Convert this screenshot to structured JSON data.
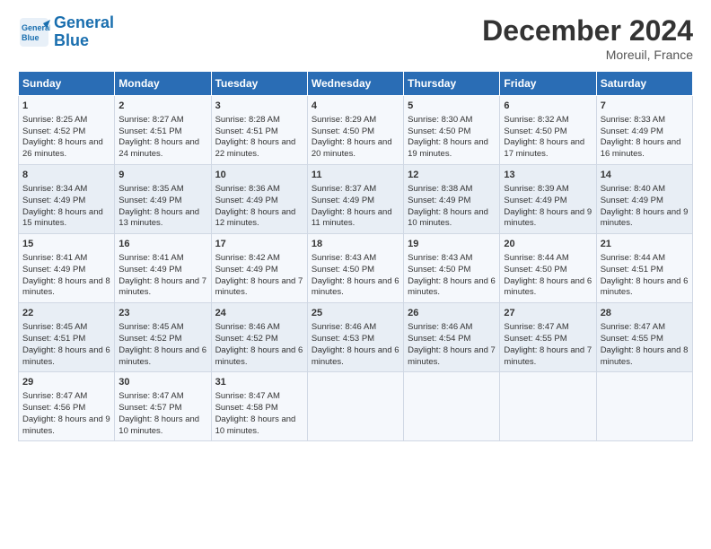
{
  "header": {
    "logo_line1": "General",
    "logo_line2": "Blue",
    "month": "December 2024",
    "location": "Moreuil, France"
  },
  "weekdays": [
    "Sunday",
    "Monday",
    "Tuesday",
    "Wednesday",
    "Thursday",
    "Friday",
    "Saturday"
  ],
  "weeks": [
    [
      {
        "day": "1",
        "sunrise": "8:25 AM",
        "sunset": "4:52 PM",
        "daylight": "8 hours and 26 minutes."
      },
      {
        "day": "2",
        "sunrise": "8:27 AM",
        "sunset": "4:51 PM",
        "daylight": "8 hours and 24 minutes."
      },
      {
        "day": "3",
        "sunrise": "8:28 AM",
        "sunset": "4:51 PM",
        "daylight": "8 hours and 22 minutes."
      },
      {
        "day": "4",
        "sunrise": "8:29 AM",
        "sunset": "4:50 PM",
        "daylight": "8 hours and 20 minutes."
      },
      {
        "day": "5",
        "sunrise": "8:30 AM",
        "sunset": "4:50 PM",
        "daylight": "8 hours and 19 minutes."
      },
      {
        "day": "6",
        "sunrise": "8:32 AM",
        "sunset": "4:50 PM",
        "daylight": "8 hours and 17 minutes."
      },
      {
        "day": "7",
        "sunrise": "8:33 AM",
        "sunset": "4:49 PM",
        "daylight": "8 hours and 16 minutes."
      }
    ],
    [
      {
        "day": "8",
        "sunrise": "8:34 AM",
        "sunset": "4:49 PM",
        "daylight": "8 hours and 15 minutes."
      },
      {
        "day": "9",
        "sunrise": "8:35 AM",
        "sunset": "4:49 PM",
        "daylight": "8 hours and 13 minutes."
      },
      {
        "day": "10",
        "sunrise": "8:36 AM",
        "sunset": "4:49 PM",
        "daylight": "8 hours and 12 minutes."
      },
      {
        "day": "11",
        "sunrise": "8:37 AM",
        "sunset": "4:49 PM",
        "daylight": "8 hours and 11 minutes."
      },
      {
        "day": "12",
        "sunrise": "8:38 AM",
        "sunset": "4:49 PM",
        "daylight": "8 hours and 10 minutes."
      },
      {
        "day": "13",
        "sunrise": "8:39 AM",
        "sunset": "4:49 PM",
        "daylight": "8 hours and 9 minutes."
      },
      {
        "day": "14",
        "sunrise": "8:40 AM",
        "sunset": "4:49 PM",
        "daylight": "8 hours and 9 minutes."
      }
    ],
    [
      {
        "day": "15",
        "sunrise": "8:41 AM",
        "sunset": "4:49 PM",
        "daylight": "8 hours and 8 minutes."
      },
      {
        "day": "16",
        "sunrise": "8:41 AM",
        "sunset": "4:49 PM",
        "daylight": "8 hours and 7 minutes."
      },
      {
        "day": "17",
        "sunrise": "8:42 AM",
        "sunset": "4:49 PM",
        "daylight": "8 hours and 7 minutes."
      },
      {
        "day": "18",
        "sunrise": "8:43 AM",
        "sunset": "4:50 PM",
        "daylight": "8 hours and 6 minutes."
      },
      {
        "day": "19",
        "sunrise": "8:43 AM",
        "sunset": "4:50 PM",
        "daylight": "8 hours and 6 minutes."
      },
      {
        "day": "20",
        "sunrise": "8:44 AM",
        "sunset": "4:50 PM",
        "daylight": "8 hours and 6 minutes."
      },
      {
        "day": "21",
        "sunrise": "8:44 AM",
        "sunset": "4:51 PM",
        "daylight": "8 hours and 6 minutes."
      }
    ],
    [
      {
        "day": "22",
        "sunrise": "8:45 AM",
        "sunset": "4:51 PM",
        "daylight": "8 hours and 6 minutes."
      },
      {
        "day": "23",
        "sunrise": "8:45 AM",
        "sunset": "4:52 PM",
        "daylight": "8 hours and 6 minutes."
      },
      {
        "day": "24",
        "sunrise": "8:46 AM",
        "sunset": "4:52 PM",
        "daylight": "8 hours and 6 minutes."
      },
      {
        "day": "25",
        "sunrise": "8:46 AM",
        "sunset": "4:53 PM",
        "daylight": "8 hours and 6 minutes."
      },
      {
        "day": "26",
        "sunrise": "8:46 AM",
        "sunset": "4:54 PM",
        "daylight": "8 hours and 7 minutes."
      },
      {
        "day": "27",
        "sunrise": "8:47 AM",
        "sunset": "4:55 PM",
        "daylight": "8 hours and 7 minutes."
      },
      {
        "day": "28",
        "sunrise": "8:47 AM",
        "sunset": "4:55 PM",
        "daylight": "8 hours and 8 minutes."
      }
    ],
    [
      {
        "day": "29",
        "sunrise": "8:47 AM",
        "sunset": "4:56 PM",
        "daylight": "8 hours and 9 minutes."
      },
      {
        "day": "30",
        "sunrise": "8:47 AM",
        "sunset": "4:57 PM",
        "daylight": "8 hours and 10 minutes."
      },
      {
        "day": "31",
        "sunrise": "8:47 AM",
        "sunset": "4:58 PM",
        "daylight": "8 hours and 10 minutes."
      },
      null,
      null,
      null,
      null
    ]
  ]
}
